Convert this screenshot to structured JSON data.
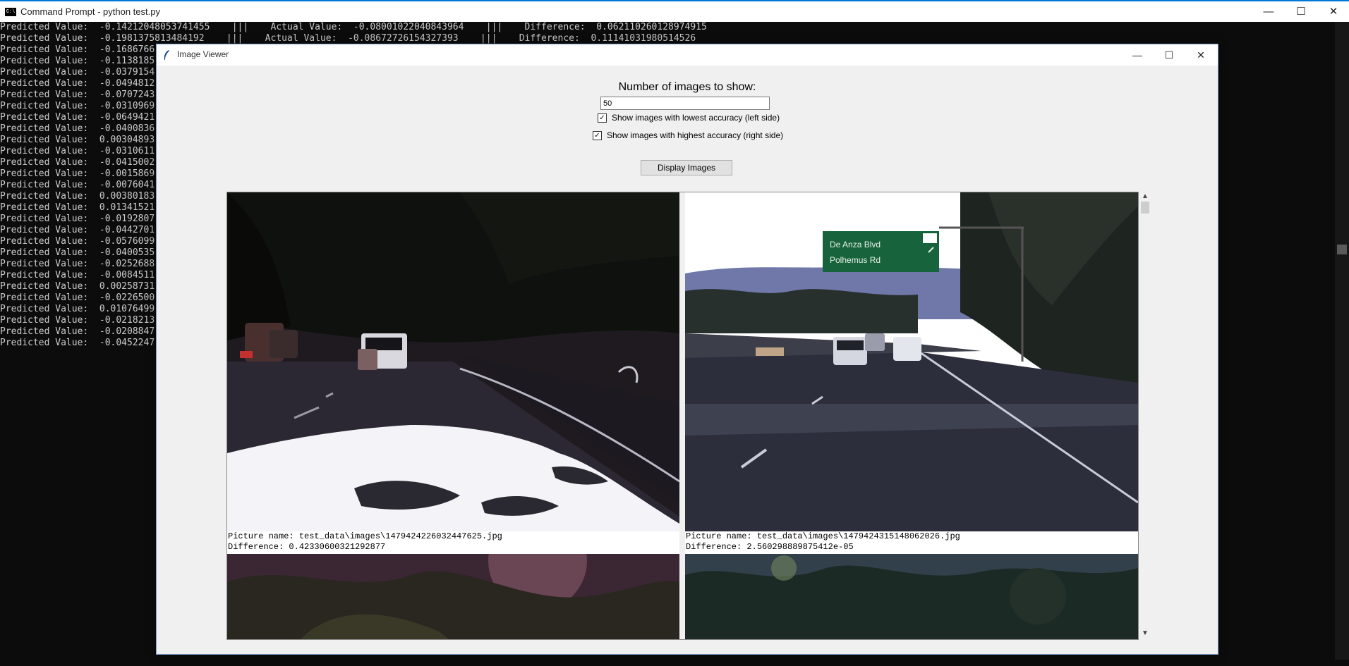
{
  "console": {
    "title": "Command Prompt - python  test.py",
    "icon_text": "C:\\",
    "lines": [
      "Predicted Value:  -0.14212048053741455    |||    Actual Value:  -0.08001022040843964    |||    Difference:  0.062110260128974915",
      "Predicted Value:  -0.1981375813484192    |||    Actual Value:  -0.08672726154327393    |||    Difference:  0.11141031980514526",
      "Predicted Value:  -0.1686766",
      "Predicted Value:  -0.1138185",
      "Predicted Value:  -0.0379154",
      "Predicted Value:  -0.0494812",
      "Predicted Value:  -0.0707243",
      "Predicted Value:  -0.0310969",
      "Predicted Value:  -0.0649421",
      "Predicted Value:  -0.0400836",
      "Predicted Value:  0.00304893",
      "Predicted Value:  -0.0310611",
      "Predicted Value:  -0.0415002",
      "Predicted Value:  -0.0015869",
      "Predicted Value:  -0.0076041",
      "Predicted Value:  0.00380183",
      "Predicted Value:  0.01341521",
      "Predicted Value:  -0.0192807",
      "Predicted Value:  -0.0442701",
      "Predicted Value:  -0.0576099",
      "Predicted Value:  -0.0400535",
      "Predicted Value:  -0.0252688",
      "Predicted Value:  -0.0084511",
      "Predicted Value:  0.00258731",
      "Predicted Value:  -0.0226500",
      "Predicted Value:  0.01076499",
      "Predicted Value:  -0.0218213",
      "Predicted Value:  -0.0208847",
      "Predicted Value:  -0.0452247"
    ],
    "window_buttons": {
      "minimize": "—",
      "maximize": "☐",
      "close": "✕"
    }
  },
  "viewer": {
    "title": "Image Viewer",
    "window_buttons": {
      "minimize": "—",
      "maximize": "☐",
      "close": "✕"
    },
    "num_label": "Number of images to show:",
    "num_value": "50",
    "check_lowest": {
      "label": "Show images with lowest accuracy (left side)",
      "checked": true,
      "mark": "✓"
    },
    "check_highest": {
      "label": "Show images with highest accuracy (right side)",
      "checked": true,
      "mark": "✓"
    },
    "display_button": "Display Images",
    "scroll_up": "▲",
    "scroll_down": "▼",
    "images": [
      {
        "name": "Picture name: test_data\\images\\1479424226032447625.jpg",
        "difference": "Difference: 0.42330600321292877"
      },
      {
        "name": "Picture name: test_data\\images\\1479424315148062026.jpg",
        "difference": "Difference: 2.560298889875412e-05"
      }
    ],
    "sign_text": [
      "De Anza Blvd",
      "Polhemus Rd"
    ]
  }
}
